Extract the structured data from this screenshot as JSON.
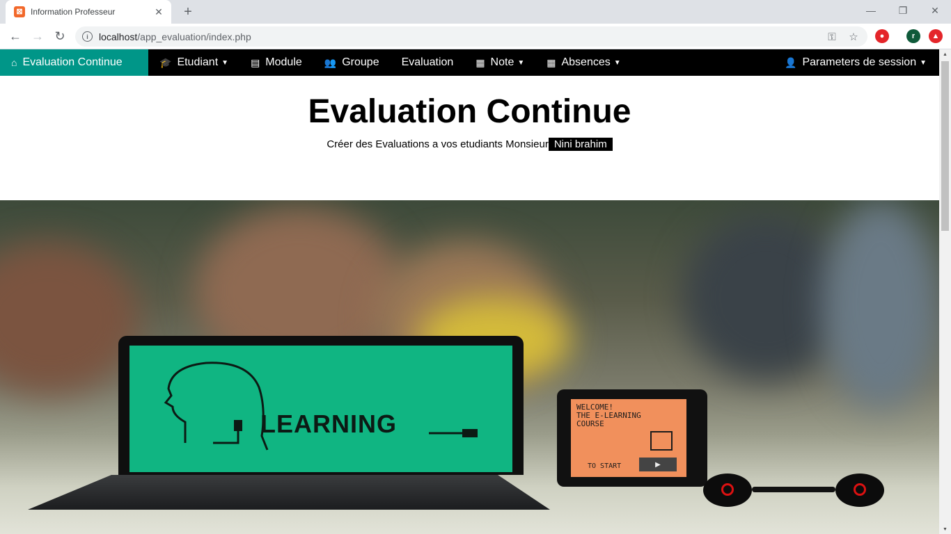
{
  "browser": {
    "tab_title": "Information Professeur",
    "url_host": "localhost",
    "url_path": "/app_evaluation/index.php",
    "profile_initial": "r"
  },
  "navbar": {
    "brand": "Evaluation Continue",
    "items": [
      {
        "label": "Etudiant",
        "icon": "graduation-cap-icon",
        "dropdown": true
      },
      {
        "label": "Module",
        "icon": "list-alt-icon",
        "dropdown": false
      },
      {
        "label": "Groupe",
        "icon": "users-icon",
        "dropdown": false
      },
      {
        "label": "Evaluation",
        "icon": "",
        "dropdown": false
      },
      {
        "label": "Note",
        "icon": "table-icon",
        "dropdown": true
      },
      {
        "label": "Absences",
        "icon": "table-icon",
        "dropdown": true
      }
    ],
    "session": "Parameters de session"
  },
  "hero": {
    "title": "Evaluation Continue",
    "subtitle": "Créer des Evaluations a vos etudiants Monsieur",
    "teacher_name": "Nini brahim"
  },
  "image": {
    "laptop_text": "LEARNING",
    "tablet_lines": [
      "WELCOME!",
      "THE E-LEARNING",
      "COURSE"
    ],
    "tablet_start": "TO START"
  },
  "colors": {
    "accent": "#009688",
    "navbar_bg": "#000000",
    "laptop_screen": "#10b582",
    "tablet_screen": "#f1905c"
  }
}
